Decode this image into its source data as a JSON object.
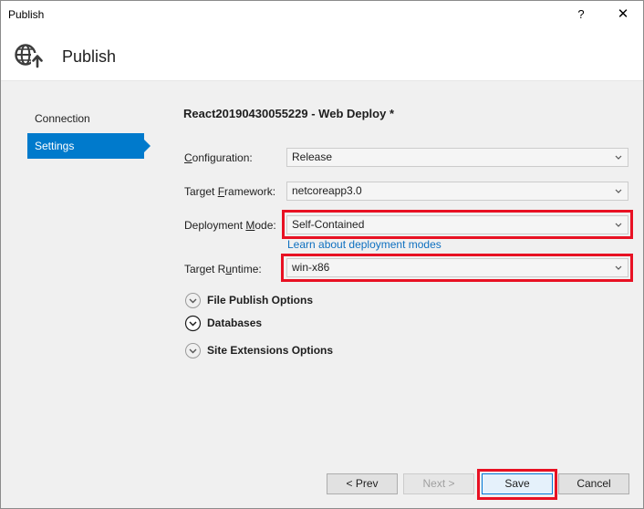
{
  "window": {
    "title": "Publish",
    "help_label": "?",
    "close_label": "✕"
  },
  "header": {
    "title": "Publish",
    "icon": "globe-publish-icon"
  },
  "sidebar": {
    "items": [
      {
        "label": "Connection",
        "selected": false
      },
      {
        "label": "Settings",
        "selected": true
      }
    ]
  },
  "main": {
    "profile_title": "React20190430055229 - Web Deploy *",
    "fields": [
      {
        "label_pre": "",
        "label_key": "C",
        "label_post": "onfiguration:",
        "value": "Release",
        "highlighted": false
      },
      {
        "label_pre": "Target ",
        "label_key": "F",
        "label_post": "ramework:",
        "value": "netcoreapp3.0",
        "highlighted": false
      },
      {
        "label_pre": "Deployment ",
        "label_key": "M",
        "label_post": "ode:",
        "value": "Self-Contained",
        "highlighted": true
      },
      {
        "label_pre": "Target R",
        "label_key": "u",
        "label_post": "ntime:",
        "value": "win-x86",
        "highlighted": true
      }
    ],
    "deployment_link": "Learn about deployment modes",
    "sections": [
      {
        "label": "File Publish Options",
        "expanded": false
      },
      {
        "label": "Databases",
        "expanded": false
      },
      {
        "label": "Site Extensions Options",
        "expanded": false
      }
    ]
  },
  "footer": {
    "prev_label": "< Prev",
    "next_label": "Next >",
    "save_label": "Save",
    "cancel_label": "Cancel",
    "save_highlighted": true
  },
  "colors": {
    "accent": "#007acc",
    "highlight": "#e81123",
    "link": "#0e70c0"
  }
}
